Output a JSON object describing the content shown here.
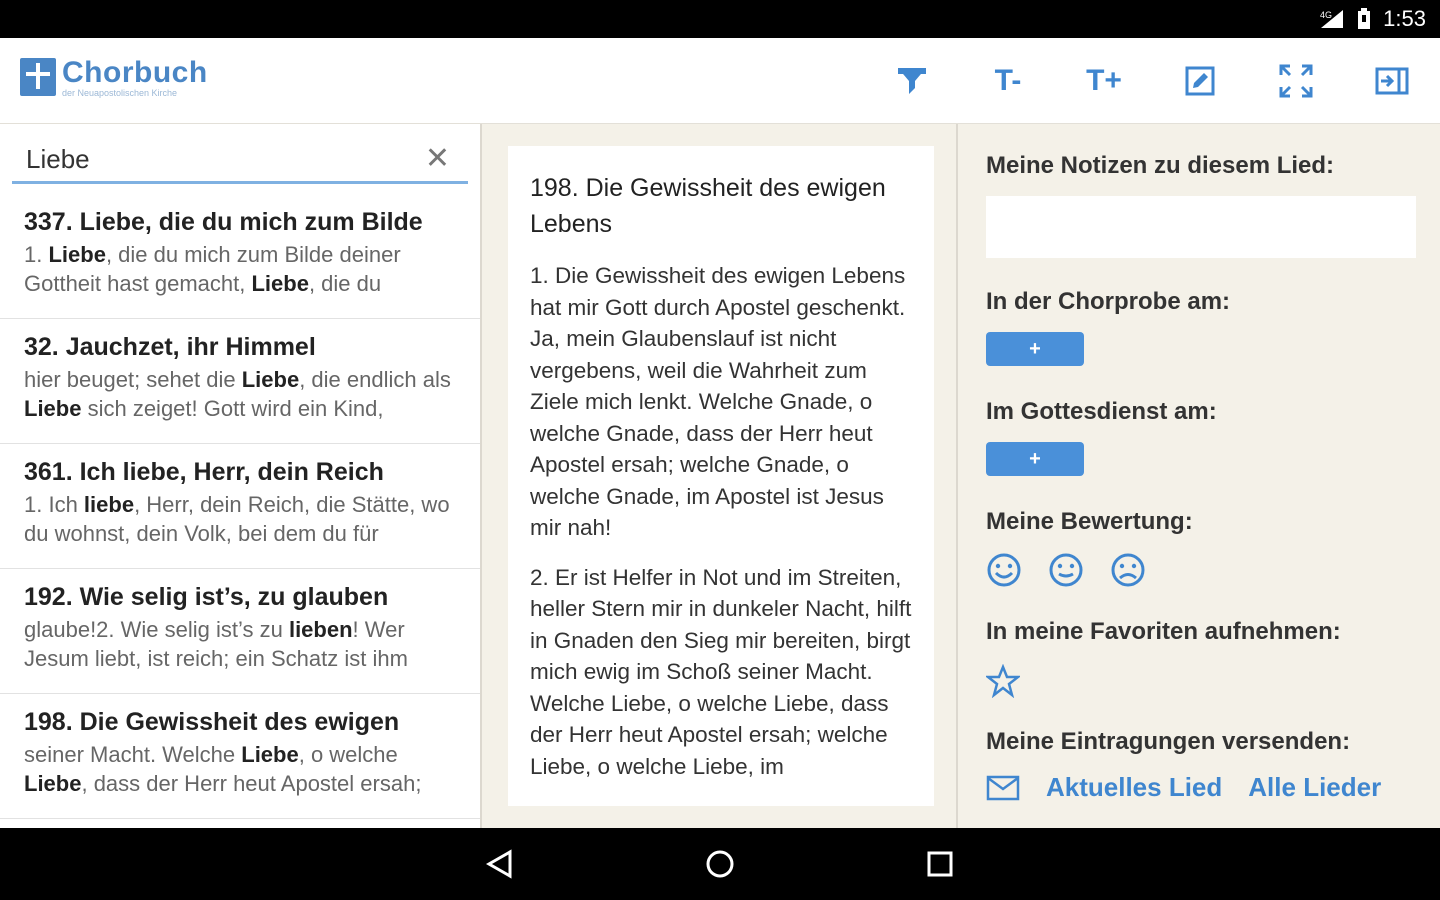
{
  "status": {
    "time": "1:53",
    "network": "4G"
  },
  "app": {
    "title": "Chorbuch",
    "subtitle": "der Neuapostolischen Kirche"
  },
  "toolbar": {
    "filter_icon": "filter-icon",
    "font_smaller_label": "T-",
    "font_larger_label": "T+",
    "edit_icon": "edit-icon",
    "fullscreen_icon": "fullscreen-icon",
    "panel_icon": "panel-collapse-icon",
    "accent": "#3f86cf"
  },
  "search": {
    "value": "Liebe",
    "placeholder": ""
  },
  "results": [
    {
      "title": "337. Liebe, die du mich zum Bilde",
      "snippet": [
        [
          "1. ",
          false
        ],
        [
          "Liebe",
          true
        ],
        [
          ", die du mich zum Bilde deiner Gottheit hast gemacht, ",
          false
        ],
        [
          "Liebe",
          true
        ],
        [
          ", die du",
          false
        ]
      ]
    },
    {
      "title": "32. Jauchzet, ihr Himmel",
      "snippet": [
        [
          "hier beuget; sehet die ",
          false
        ],
        [
          "Liebe",
          true
        ],
        [
          ", die endlich als ",
          false
        ],
        [
          "Liebe",
          true
        ],
        [
          " sich zeiget! Gott wird ein Kind,",
          false
        ]
      ]
    },
    {
      "title": "361. Ich liebe, Herr, dein Reich",
      "snippet": [
        [
          "1. Ich ",
          false
        ],
        [
          "liebe",
          true
        ],
        [
          ", Herr, dein Reich, die Stätte, wo du wohnst, dein Volk, bei dem du für",
          false
        ]
      ]
    },
    {
      "title": "192. Wie selig ist’s, zu glauben",
      "snippet": [
        [
          "glaube!2. Wie selig ist’s zu ",
          false
        ],
        [
          "lieben",
          true
        ],
        [
          "! Wer Jesum liebt, ist reich; ein Schatz ist ihm",
          false
        ]
      ]
    },
    {
      "title": "198. Die Gewissheit des ewigen",
      "snippet": [
        [
          "seiner Macht. Welche ",
          false
        ],
        [
          "Liebe",
          true
        ],
        [
          ", o welche ",
          false
        ],
        [
          "Liebe",
          true
        ],
        [
          ", dass der Herr heut Apostel ersah;",
          false
        ]
      ]
    }
  ],
  "song": {
    "title": "198. Die Gewissheit des ewigen Lebens",
    "verse1": "1. Die Gewissheit des ewigen Lebens hat mir Gott durch Apostel geschenkt. Ja, mein Glaubenslauf ist nicht vergebens, weil die Wahrheit zum Ziele mich lenkt. Welche Gnade, o welche Gnade, dass der Herr heut Apostel ersah; welche Gnade, o welche Gnade, im Apostel ist Jesus mir nah!",
    "verse2": "2. Er ist Helfer in Not und im Streiten, heller Stern mir in dunkeler Nacht, hilft in Gnaden den Sieg mir bereiten, birgt mich ewig im Schoß seiner Macht. Welche Liebe, o welche Liebe, dass der Herr heut Apostel ersah; welche Liebe, o welche Liebe, im"
  },
  "details": {
    "notes_label": "Meine Notizen zu diesem Lied:",
    "notes_value": "",
    "rehearsal_label": "In der Chorprobe am:",
    "service_label": "Im Gottesdienst am:",
    "add_label": "+",
    "rating_label": "Meine Bewertung:",
    "rating_icons": [
      "smiley-happy-icon",
      "smiley-neutral-icon",
      "smiley-sad-icon"
    ],
    "favorites_label": "In meine Favoriten aufnehmen:",
    "share_label": "Meine Eintragungen versenden:",
    "current_song_link": "Aktuelles Lied",
    "all_songs_link": "Alle Lieder"
  }
}
